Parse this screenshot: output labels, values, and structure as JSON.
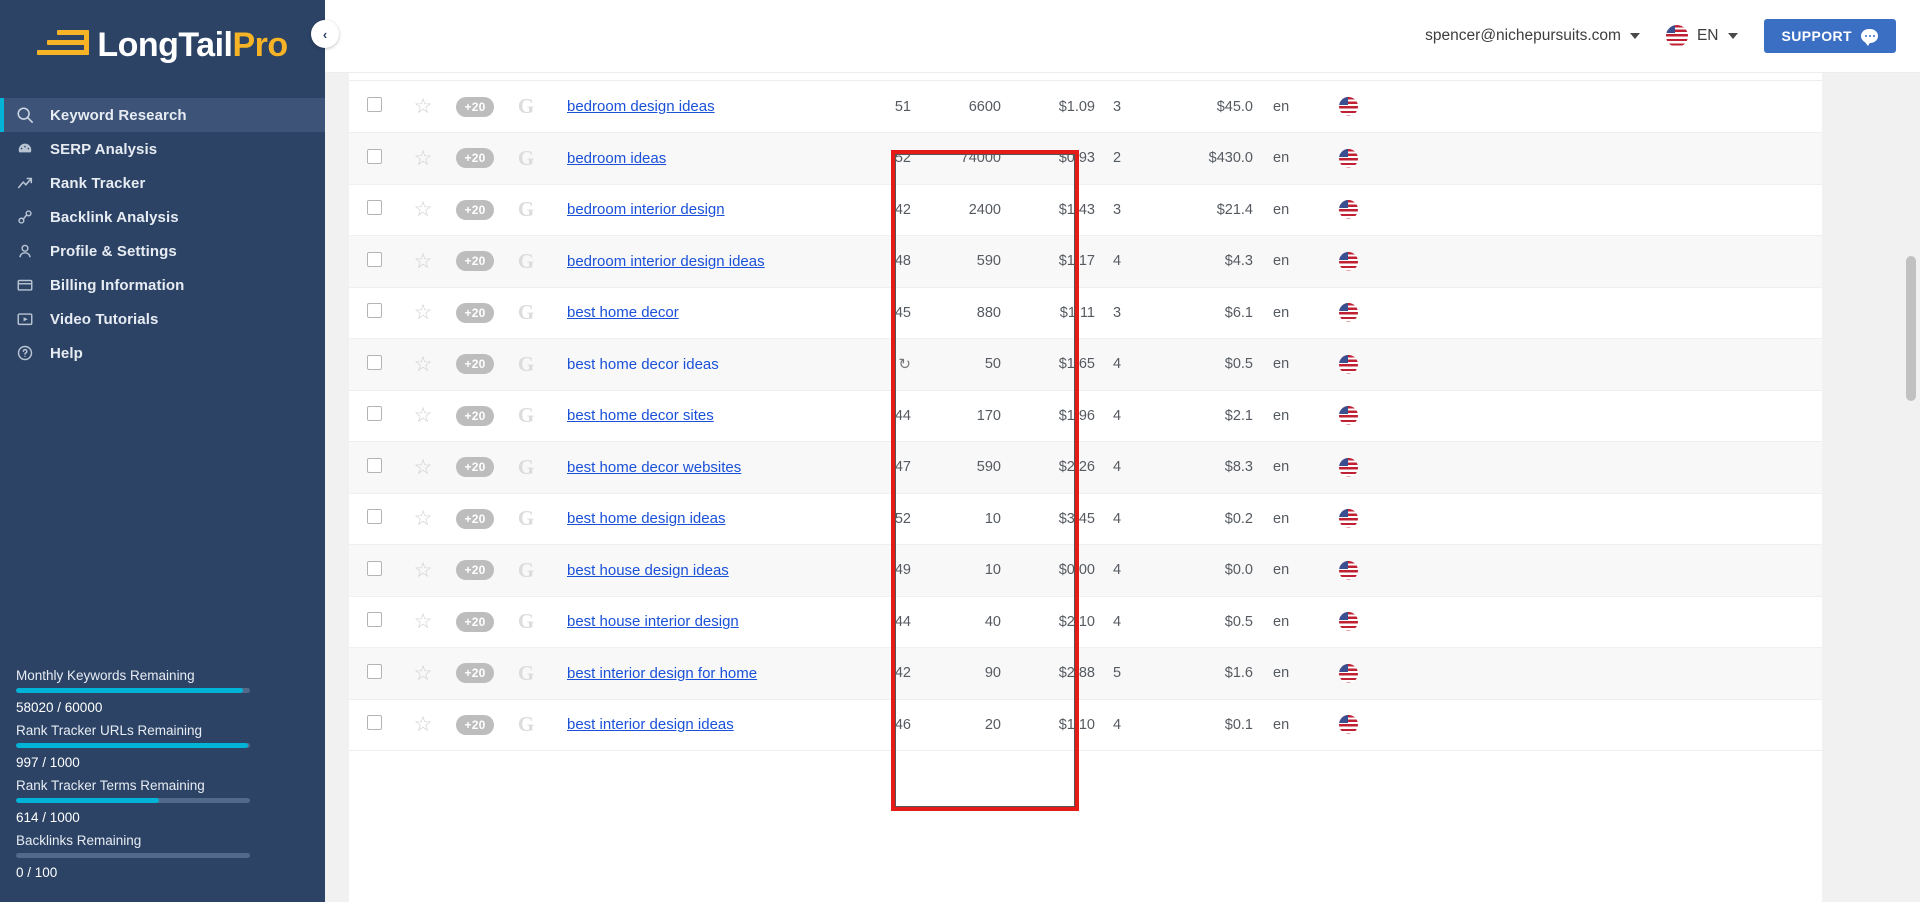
{
  "brand": {
    "logo_long": "Long",
    "logo_tail": "Tail",
    "logo_pro": "Pro",
    "accent_yellow": "#f5b325",
    "sidebar_blue": "#2c4365",
    "cyan": "#00b3d7",
    "link_blue": "#1a51d8",
    "highlight_red": "#e41b17"
  },
  "sidebar": {
    "collapse_label": "‹",
    "items": [
      {
        "label": "Keyword Research",
        "icon": "search-icon",
        "active": true
      },
      {
        "label": "SERP Analysis",
        "icon": "gauge-icon",
        "active": false
      },
      {
        "label": "Rank Tracker",
        "icon": "trend-up-icon",
        "active": false
      },
      {
        "label": "Backlink Analysis",
        "icon": "link-icon",
        "active": false
      },
      {
        "label": "Profile & Settings",
        "icon": "user-icon",
        "active": false
      },
      {
        "label": "Billing Information",
        "icon": "credit-card-icon",
        "active": false
      },
      {
        "label": "Video Tutorials",
        "icon": "video-icon",
        "active": false
      },
      {
        "label": "Help",
        "icon": "help-icon",
        "active": false
      }
    ],
    "quotas": [
      {
        "label": "Monthly Keywords Remaining",
        "value": "58020 / 60000",
        "percent": 97
      },
      {
        "label": "Rank Tracker URLs Remaining",
        "value": "997 / 1000",
        "percent": 99
      },
      {
        "label": "Rank Tracker Terms Remaining",
        "value": "614 / 1000",
        "percent": 61
      },
      {
        "label": "Backlinks Remaining",
        "value": "0 / 100",
        "percent": 0
      }
    ]
  },
  "topbar": {
    "account_email": "spencer@nichepursuits.com",
    "language": "EN",
    "support_label": "SUPPORT"
  },
  "table": {
    "plus_badge_label": "+20",
    "google_glyph": "G",
    "star_glyph": "☆",
    "sync_glyph": "↻",
    "rows": [
      {
        "keyword": "bedroom design ideas",
        "underlined": true,
        "kc": "51",
        "volume": "6600",
        "cpc": "$1.09",
        "comp": "3",
        "bid": "$45.0",
        "lang": "en",
        "flag": "us-flag-icon"
      },
      {
        "keyword": "bedroom ideas",
        "underlined": true,
        "kc": "52",
        "volume": "74000",
        "cpc": "$0.93",
        "comp": "2",
        "bid": "$430.0",
        "lang": "en",
        "flag": "us-flag-icon"
      },
      {
        "keyword": "bedroom interior design",
        "underlined": true,
        "kc": "42",
        "volume": "2400",
        "cpc": "$1.43",
        "comp": "3",
        "bid": "$21.4",
        "lang": "en",
        "flag": "us-flag-icon"
      },
      {
        "keyword": "bedroom interior design ideas",
        "underlined": true,
        "kc": "48",
        "volume": "590",
        "cpc": "$1.17",
        "comp": "4",
        "bid": "$4.3",
        "lang": "en",
        "flag": "us-flag-icon"
      },
      {
        "keyword": "best home decor",
        "underlined": true,
        "kc": "45",
        "volume": "880",
        "cpc": "$1.11",
        "comp": "3",
        "bid": "$6.1",
        "lang": "en",
        "flag": "us-flag-icon"
      },
      {
        "keyword": "best home decor ideas",
        "underlined": false,
        "kc": "",
        "kc_icon": "sync-icon",
        "volume": "50",
        "cpc": "$1.65",
        "comp": "4",
        "bid": "$0.5",
        "lang": "en",
        "flag": "us-flag-icon"
      },
      {
        "keyword": "best home decor sites",
        "underlined": true,
        "kc": "44",
        "volume": "170",
        "cpc": "$1.96",
        "comp": "4",
        "bid": "$2.1",
        "lang": "en",
        "flag": "us-flag-icon"
      },
      {
        "keyword": "best home decor websites",
        "underlined": true,
        "kc": "47",
        "volume": "590",
        "cpc": "$2.26",
        "comp": "4",
        "bid": "$8.3",
        "lang": "en",
        "flag": "us-flag-icon"
      },
      {
        "keyword": "best home design ideas",
        "underlined": true,
        "kc": "52",
        "volume": "10",
        "cpc": "$3.45",
        "comp": "4",
        "bid": "$0.2",
        "lang": "en",
        "flag": "us-flag-icon"
      },
      {
        "keyword": "best house design ideas",
        "underlined": true,
        "kc": "49",
        "volume": "10",
        "cpc": "$0.00",
        "comp": "4",
        "bid": "$0.0",
        "lang": "en",
        "flag": "us-flag-icon"
      },
      {
        "keyword": "best house interior design",
        "underlined": true,
        "kc": "44",
        "volume": "40",
        "cpc": "$2.10",
        "comp": "4",
        "bid": "$0.5",
        "lang": "en",
        "flag": "us-flag-icon"
      },
      {
        "keyword": "best interior design for home",
        "underlined": true,
        "kc": "42",
        "volume": "90",
        "cpc": "$2.88",
        "comp": "5",
        "bid": "$1.6",
        "lang": "en",
        "flag": "us-flag-icon"
      },
      {
        "keyword": "best interior design ideas",
        "underlined": true,
        "kc": "46",
        "volume": "20",
        "cpc": "$1.10",
        "comp": "4",
        "bid": "$0.1",
        "lang": "en",
        "flag": "us-flag-icon"
      }
    ]
  }
}
